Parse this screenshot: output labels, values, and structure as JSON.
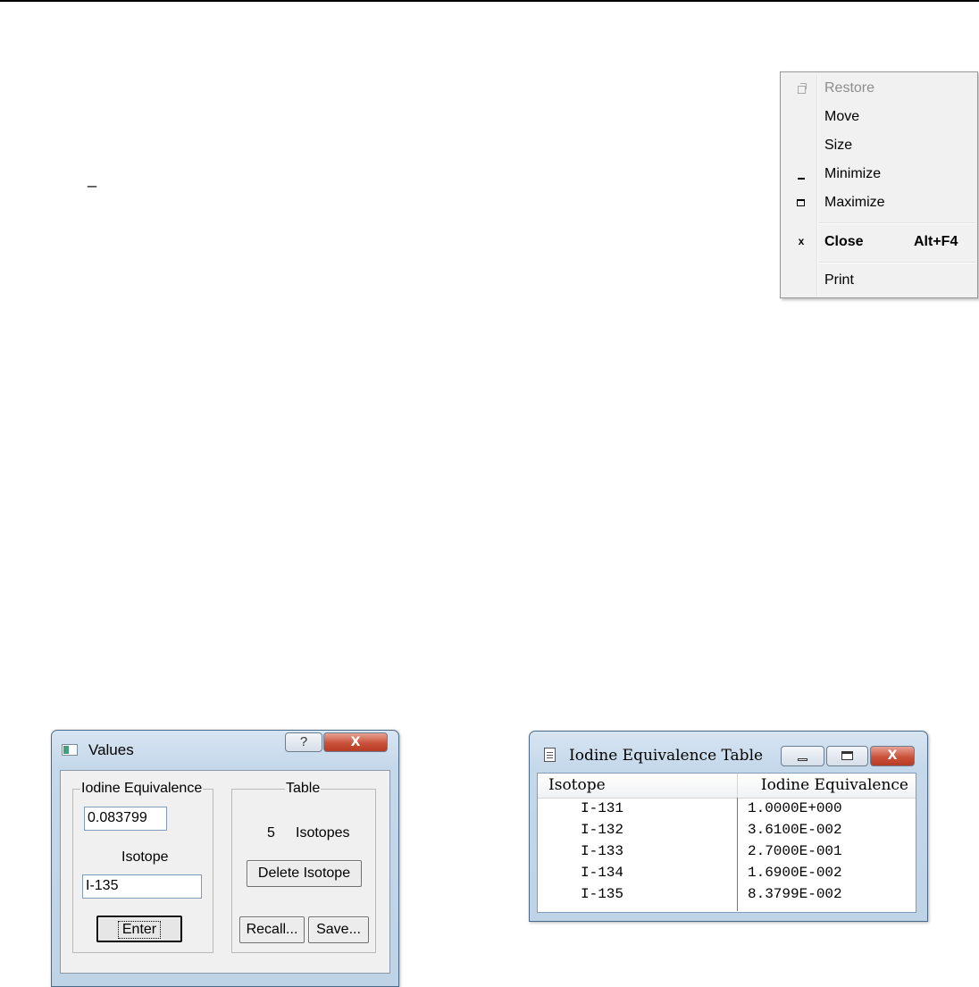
{
  "system_menu": {
    "items": [
      {
        "label": "Restore",
        "icon": "restore-icon",
        "disabled": true
      },
      {
        "label": "Move",
        "icon": "",
        "disabled": false
      },
      {
        "label": "Size",
        "icon": "",
        "disabled": false
      },
      {
        "label": "Minimize",
        "icon": "minimize-icon",
        "disabled": false
      },
      {
        "label": "Maximize",
        "icon": "maximize-icon",
        "disabled": false
      },
      {
        "label": "Close",
        "icon": "close-icon",
        "shortcut": "Alt+F4",
        "bold": true
      },
      {
        "label": "Print",
        "icon": ""
      }
    ],
    "close_glyph": "x"
  },
  "values_dialog": {
    "title": "Values",
    "help_glyph": "?",
    "close_glyph": "X",
    "iodine_group": {
      "legend": "Iodine Equivalence",
      "value": "0.083799",
      "isotope_label": "Isotope",
      "isotope_value": "I-135",
      "enter_label": "Enter"
    },
    "table_group": {
      "legend": "Table",
      "count": "5",
      "count_label": "Isotopes",
      "delete_label": "Delete Isotope",
      "recall_label": "Recall...",
      "save_label": "Save..."
    }
  },
  "table_window": {
    "title": "Iodine Equivalence Table",
    "close_glyph": "X",
    "columns": [
      "Isotope",
      "Iodine Equivalence"
    ],
    "rows": [
      {
        "isotope": "I-131",
        "value": "1.0000E+000"
      },
      {
        "isotope": "I-132",
        "value": "3.6100E-002"
      },
      {
        "isotope": "I-133",
        "value": "2.7000E-001"
      },
      {
        "isotope": "I-134",
        "value": "1.6900E-002"
      },
      {
        "isotope": "I-135",
        "value": "8.3799E-002"
      }
    ]
  },
  "colors": {
    "title_close_red": "#c9513a",
    "frame_blue": "#c5d8ea",
    "disabled_text": "#8d8d8d"
  }
}
